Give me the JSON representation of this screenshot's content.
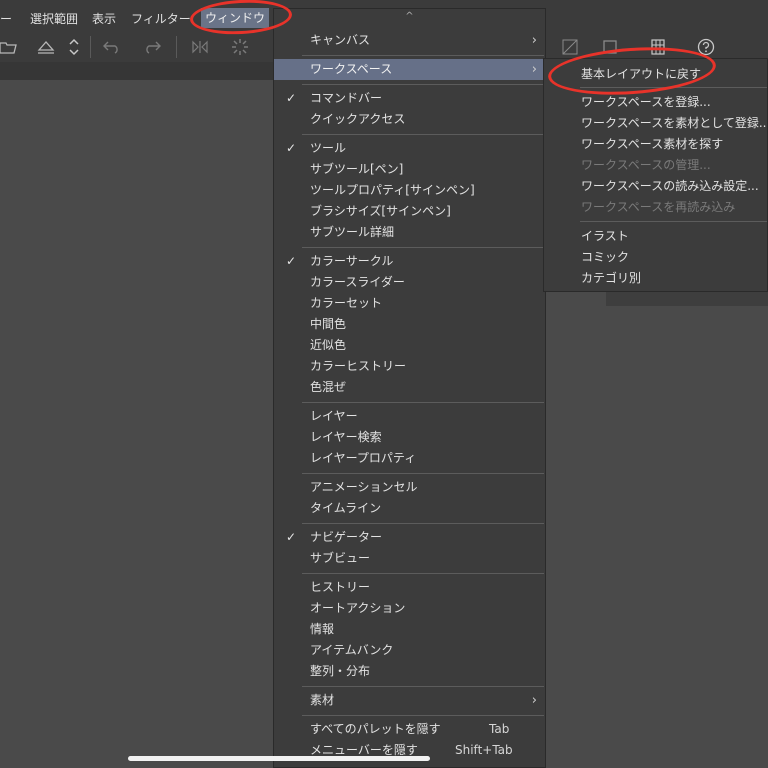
{
  "menubar": {
    "items": [
      "ー",
      "選択範囲",
      "表示",
      "フィルター",
      "ウィンドウ"
    ]
  },
  "toolbar": {
    "icons": [
      "open-folder-icon",
      "bucket-icon",
      "up-down-arrows-icon",
      "undo-icon",
      "redo-icon",
      "flip-icon",
      "loading-spinner-icon",
      "transparency-icon",
      "square-icon",
      "grid-icon",
      "help-icon"
    ]
  },
  "main_menu": {
    "items": [
      {
        "label": "キャンバス",
        "check": false,
        "arrow": true
      },
      {
        "label": "ワークスペース",
        "check": false,
        "arrow": true,
        "highlighted": true
      },
      {
        "label": "コマンドバー",
        "check": true
      },
      {
        "label": "クイックアクセス",
        "check": false
      },
      {
        "label": "ツール",
        "check": true
      },
      {
        "label": "サブツール[ペン]",
        "check": false
      },
      {
        "label": "ツールプロパティ[サインペン]",
        "check": false
      },
      {
        "label": "ブラシサイズ[サインペン]",
        "check": false
      },
      {
        "label": "サブツール詳細",
        "check": false
      },
      {
        "label": "カラーサークル",
        "check": true
      },
      {
        "label": "カラースライダー",
        "check": false
      },
      {
        "label": "カラーセット",
        "check": false
      },
      {
        "label": "中間色",
        "check": false
      },
      {
        "label": "近似色",
        "check": false
      },
      {
        "label": "カラーヒストリー",
        "check": false
      },
      {
        "label": "色混ぜ",
        "check": false
      },
      {
        "label": "レイヤー",
        "check": false
      },
      {
        "label": "レイヤー検索",
        "check": false
      },
      {
        "label": "レイヤープロパティ",
        "check": false
      },
      {
        "label": "アニメーションセル",
        "check": false
      },
      {
        "label": "タイムライン",
        "check": false
      },
      {
        "label": "ナビゲーター",
        "check": true
      },
      {
        "label": "サブビュー",
        "check": false
      },
      {
        "label": "ヒストリー",
        "check": false
      },
      {
        "label": "オートアクション",
        "check": false
      },
      {
        "label": "情報",
        "check": false
      },
      {
        "label": "アイテムバンク",
        "check": false
      },
      {
        "label": "整列・分布",
        "check": false
      },
      {
        "label": "素材",
        "check": false,
        "arrow": true
      },
      {
        "label": "すべてのパレットを隠す",
        "check": false,
        "shortcut": "Tab"
      },
      {
        "label": "メニューバーを隠す",
        "check": false,
        "shortcut": "Shift+Tab"
      }
    ],
    "check_glyph": "✓",
    "arrow_glyph": "›",
    "scroll_up_glyph": "^"
  },
  "sub_menu": {
    "items": [
      {
        "label": "基本レイアウトに戻す",
        "disabled": false
      },
      {
        "label": "ワークスペースを登録...",
        "disabled": false
      },
      {
        "label": "ワークスペースを素材として登録...",
        "disabled": false
      },
      {
        "label": "ワークスペース素材を探す",
        "disabled": false
      },
      {
        "label": "ワークスペースの管理...",
        "disabled": true
      },
      {
        "label": "ワークスペースの読み込み設定...",
        "disabled": false
      },
      {
        "label": "ワークスペースを再読み込み",
        "disabled": true
      },
      {
        "label": "イラスト",
        "disabled": false
      },
      {
        "label": "コミック",
        "disabled": false
      },
      {
        "label": "カテゴリ別",
        "disabled": false
      }
    ]
  },
  "annotations": {
    "color": "#e8332a"
  },
  "colors": {
    "highlight": "#667088",
    "menu_bg": "#3c3c3c",
    "app_bg": "#4a4a4a"
  }
}
